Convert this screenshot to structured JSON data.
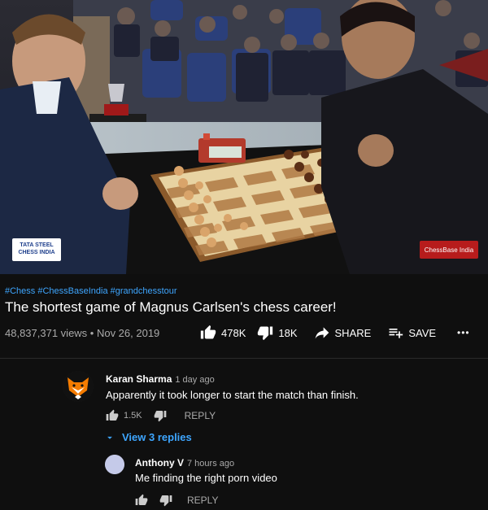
{
  "video": {
    "sponsor_line1": "TATA STEEL",
    "sponsor_line2": "CHESS INDIA",
    "watermark": "ChessBase India"
  },
  "info": {
    "hashtags": "#Chess #ChessBaseIndia #grandchesstour",
    "title": "The shortest game of Magnus Carlsen's chess career!",
    "views_date": "48,837,371 views • Nov 26, 2019",
    "like_count": "478K",
    "dislike_count": "18K",
    "share_label": "SHARE",
    "save_label": "SAVE",
    "more_label": "•••"
  },
  "comments": [
    {
      "author": "Karan Sharma",
      "time": "1 day ago",
      "text": "Apparently it took longer to start the match than finish.",
      "likes": "1.5K",
      "reply_label": "REPLY",
      "view_replies": "View 3 replies",
      "avatar_color": "#f57c00"
    }
  ],
  "reply": {
    "author": "Anthony V",
    "time": "7 hours ago",
    "text": "Me finding the right porn video",
    "reply_label": "REPLY",
    "avatar_color": "#c5cae9"
  },
  "colors": {
    "link": "#3ea6ff",
    "background": "#0f0f0f",
    "muted": "#aaaaaa"
  },
  "icons": [
    "thumb-up-icon",
    "thumb-down-icon",
    "share-icon",
    "playlist-add-icon",
    "more-icon",
    "chevron-down-icon"
  ]
}
